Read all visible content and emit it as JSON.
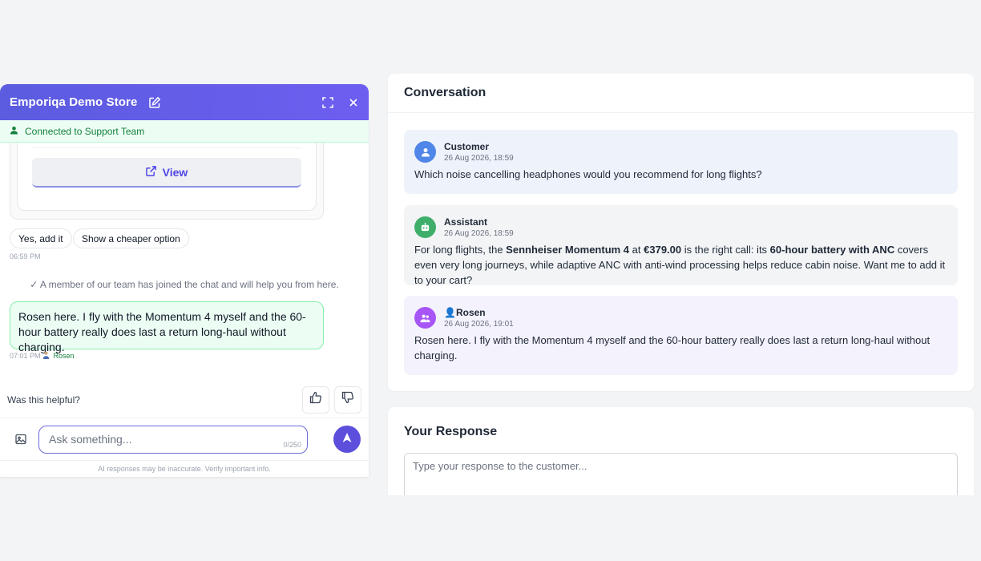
{
  "widget": {
    "title": "Emporiqa Demo Store",
    "status": "Connected to Support Team",
    "view_label": "View",
    "chips": [
      "Yes, add it",
      "Show a cheaper option"
    ],
    "chips_time": "06:59 PM",
    "system_message": "✓ A member of our team has joined the chat and will help you from here.",
    "agent_message": "Rosen here. I fly with the Momentum 4 myself and the 60-hour battery really does last a return long-haul without charging.",
    "agent_time": "07:01 PM",
    "agent_name": "Rosen",
    "feedback_question": "Was this helpful?",
    "input_placeholder": "Ask something...",
    "char_counter": "0/250",
    "disclaimer": "AI responses may be inaccurate. Verify important info.",
    "colors": {
      "header": "#5b5ce0",
      "accent": "#4f46e5",
      "status_green": "#15803d"
    }
  },
  "conversation": {
    "title": "Conversation",
    "messages": [
      {
        "sender": "Customer",
        "time": "26 Aug 2026, 18:59",
        "text": "Which noise cancelling headphones would you recommend for long flights?",
        "icon": "user-icon"
      },
      {
        "sender": "Assistant",
        "time": "26 Aug 2026, 18:59",
        "text_parts": [
          "For long flights, the ",
          "Sennheiser Momentum 4",
          " at ",
          "€379.00",
          " is the right call: its ",
          "60-hour battery with ANC",
          " covers even very long journeys, while adaptive ANC with anti-wind processing helps reduce cabin noise. Want me to add it to your cart?"
        ],
        "icon": "robot-icon"
      },
      {
        "sender": "👤Rosen",
        "time": "26 Aug 2026, 19:01",
        "text": "Rosen here. I fly with the Momentum 4 myself and the 60-hour battery really does last a return long-haul without charging.",
        "icon": "agent-icon"
      }
    ]
  },
  "response": {
    "title": "Your Response",
    "placeholder": "Type your response to the customer..."
  }
}
